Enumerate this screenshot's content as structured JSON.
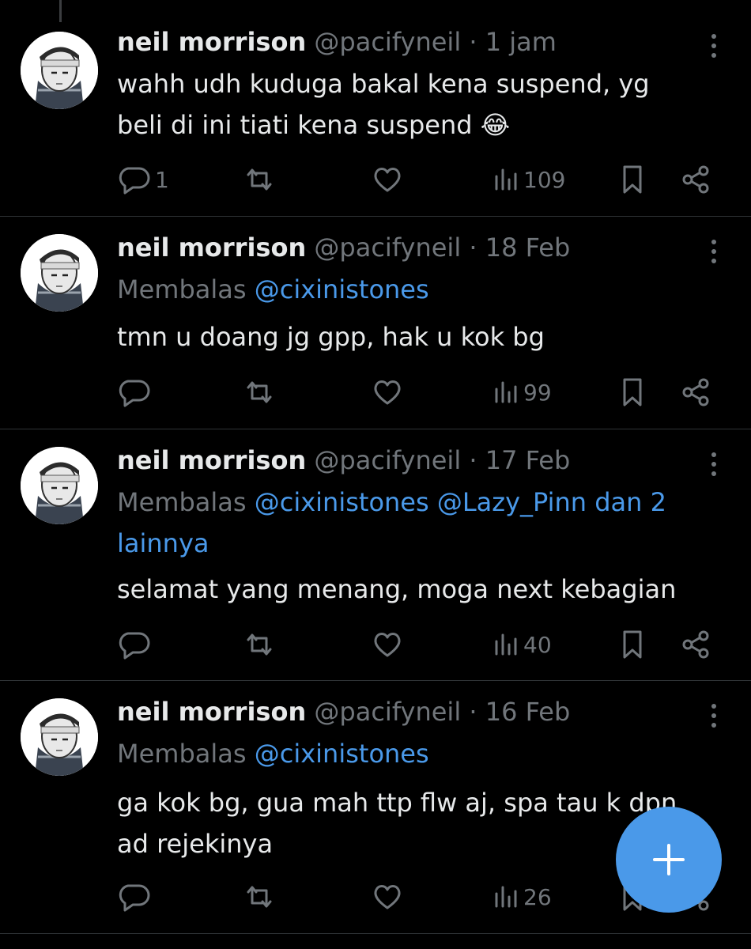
{
  "posts": [
    {
      "name": "neil morrison",
      "handle": "@pacifyneil",
      "separator": "·",
      "time": "1 jam",
      "reply_label": "",
      "reply_mentions": [],
      "text_lines": [
        "wahh udh kuduga bakal kena suspend, yg",
        "beli di ini tiati kena suspend"
      ],
      "emoji": "😂",
      "reply_count": "1",
      "views": "109"
    },
    {
      "name": "neil morrison",
      "handle": "@pacifyneil",
      "separator": "·",
      "time": "18 Feb",
      "reply_label": "Membalas",
      "reply_mentions": [
        "@cixinistones"
      ],
      "text_lines": [
        "tmn u doang jg gpp, hak u kok bg"
      ],
      "reply_count": "",
      "views": "99"
    },
    {
      "name": "neil morrison",
      "handle": "@pacifyneil",
      "separator": "·",
      "time": "17 Feb",
      "reply_label": "Membalas",
      "reply_mentions": [
        "@cixinistones",
        "@Lazy_Pinn dan 2",
        "lainnya"
      ],
      "text_lines": [
        "selamat yang menang, moga next kebagian"
      ],
      "reply_count": "",
      "views": "40"
    },
    {
      "name": "neil morrison",
      "handle": "@pacifyneil",
      "separator": "·",
      "time": "16 Feb",
      "reply_label": "Membalas",
      "reply_mentions": [
        "@cixinistones"
      ],
      "text_lines": [
        "ga kok bg, gua mah ttp flw aj, spa tau k dpn",
        "ad rejekinya"
      ],
      "reply_count": "",
      "views": "26"
    }
  ],
  "fab": {
    "icon": "plus-icon"
  },
  "colors": {
    "background": "#000000",
    "text": "#e7e9ea",
    "muted": "#71767b",
    "accent": "#4a99e9",
    "divider": "#2f3336"
  }
}
